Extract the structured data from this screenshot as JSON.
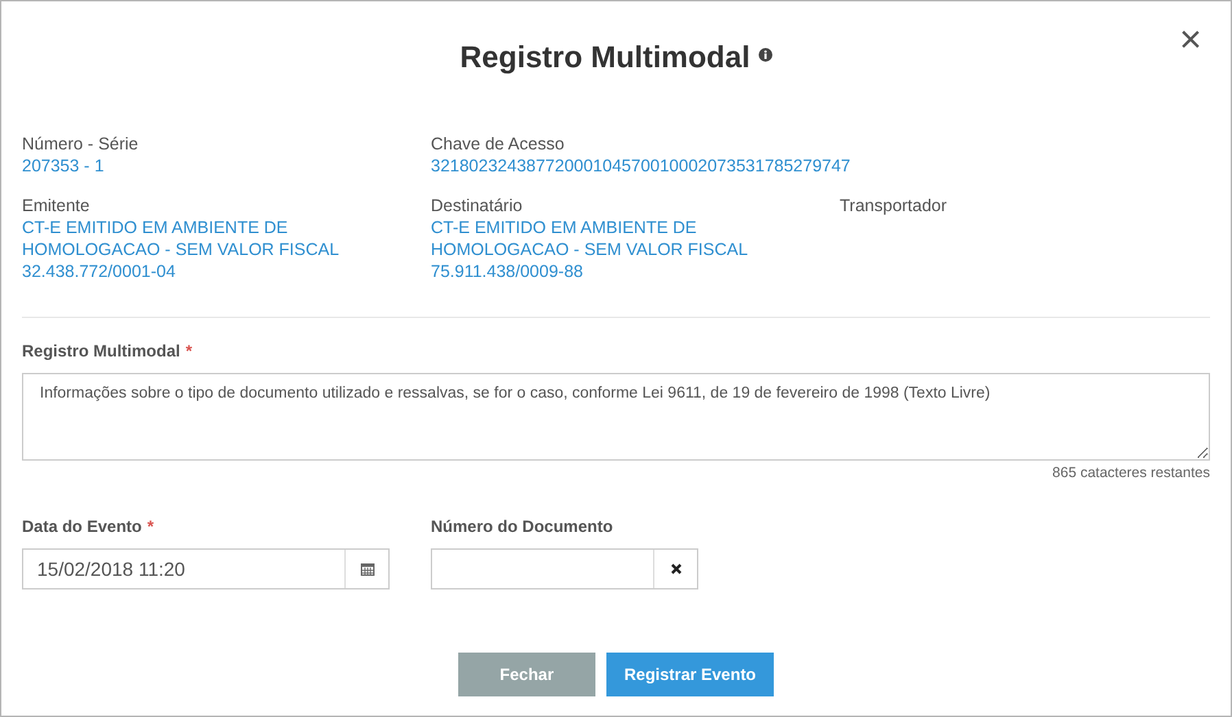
{
  "dialog": {
    "title": "Registro Multimodal",
    "close": "×"
  },
  "info_rows": [
    [
      {
        "label": "Número - Série",
        "lines": [
          "207353 - 1"
        ]
      },
      {
        "label": "Chave de Acesso",
        "lines": [
          "32180232438772000104570010002073531785279747"
        ]
      }
    ],
    [
      {
        "label": "Emitente",
        "lines": [
          "CT-E EMITIDO EM AMBIENTE DE",
          "HOMOLOGACAO - SEM VALOR FISCAL",
          "32.438.772/0001-04"
        ]
      },
      {
        "label": "Destinatário",
        "lines": [
          "CT-E EMITIDO EM AMBIENTE DE",
          "HOMOLOGACAO - SEM VALOR FISCAL",
          "75.911.438/0009-88"
        ]
      },
      {
        "label": "Transportador"
      }
    ]
  ],
  "registro": {
    "label": "Registro Multimodal",
    "required_mark": "*",
    "value": "Informações sobre o tipo de documento utilizado e ressalvas, se for o caso, conforme Lei 9611, de 19 de fevereiro de 1998 (Texto Livre)",
    "counter": "865 catacteres restantes"
  },
  "fields": [
    {
      "kind": "date",
      "label": "Data do Evento",
      "required_mark": "*",
      "value": "15/02/2018 11:20"
    },
    {
      "kind": "clear",
      "label": "Número do Documento"
    }
  ],
  "buttons": [
    {
      "kind": "secondary",
      "label": "Fechar"
    },
    {
      "kind": "primary",
      "label": "Registrar Evento"
    }
  ]
}
